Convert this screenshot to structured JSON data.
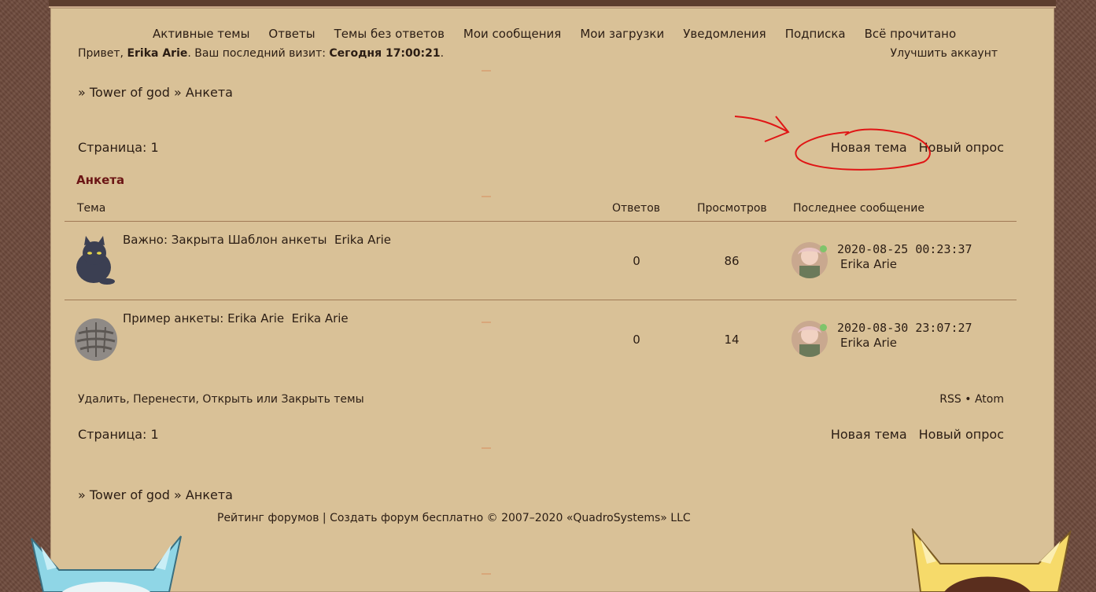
{
  "nav": {
    "items": [
      "Активные темы",
      "Ответы",
      "Темы без ответов",
      "Мои сообщения",
      "Мои загрузки",
      "Уведомления",
      "Подписка",
      "Всё прочитано"
    ]
  },
  "greeting": {
    "prefix": "Привет,",
    "username": "Erika Arie",
    "last_visit_label": ". Ваш последний визит:",
    "last_visit_value": "Сегодня 17:00:21",
    "end": "."
  },
  "upgrade_label": "Улучшить аккаунт",
  "breadcrumb": {
    "sep1": "»",
    "forum": "Tower of god",
    "sep2": "»",
    "section": "Анкета"
  },
  "pagination": {
    "label": "Страница:",
    "page": "1"
  },
  "actions": {
    "new_topic": "Новая тема",
    "new_poll": "Новый опрос"
  },
  "section_title": "Анкета",
  "table": {
    "headers": {
      "topic": "Тема",
      "replies": "Ответов",
      "views": "Просмотров",
      "last": "Последнее сообщение"
    },
    "rows": [
      {
        "title": "Важно: Закрыта Шаблон анкеты",
        "author": "Erika Arie",
        "replies": "0",
        "views": "86",
        "last_date": "2020-08-25 00:23:37",
        "last_user": "Erika Arie",
        "icon": "black-cat-icon"
      },
      {
        "title": "Пример анкеты: Erika Arie",
        "author": "Erika Arie",
        "replies": "0",
        "views": "14",
        "last_date": "2020-08-30 23:07:27",
        "last_user": "Erika Arie",
        "icon": "tabby-cat-icon"
      }
    ]
  },
  "moderation": {
    "delete": "Удалить",
    "comma1": ",",
    "move": "Перенести",
    "comma2": ",",
    "open": "Открыть",
    "or": "или",
    "close": "Закрыть темы"
  },
  "feeds": {
    "rss": "RSS",
    "dot": "•",
    "atom": "Atom"
  },
  "footer": {
    "rating": "Рейтинг форумов",
    "sep": "|",
    "create": "Создать форум бесплатно",
    "copyright": "© 2007–2020 «QuadroSystems» LLC"
  },
  "colors": {
    "panel": "#d9c197",
    "section_title": "#6b1515",
    "annotation": "#e01515"
  }
}
